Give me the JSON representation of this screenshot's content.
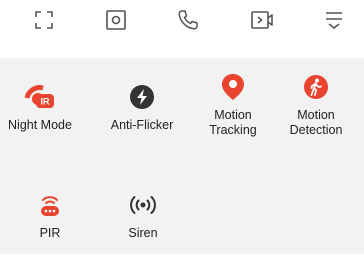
{
  "toolbar": {
    "icons": [
      "fullscreen-icon",
      "snapshot-icon",
      "call-icon",
      "record-video-icon",
      "more-menu-icon"
    ],
    "icon_color": "#555555"
  },
  "accent_color": "#e8442f",
  "features": [
    {
      "label": "Night Mode",
      "icon": "night-mode-ir-icon",
      "color": "#e8442f"
    },
    {
      "label": "Anti-Flicker",
      "icon": "lightning-icon",
      "color": "#333333"
    },
    {
      "label": "Motion\nTracking",
      "icon": "location-pin-icon",
      "color": "#e8442f"
    },
    {
      "label": "Motion\nDetection",
      "icon": "walking-person-icon",
      "color": "#e8442f"
    },
    {
      "label": "PIR",
      "icon": "pir-sensor-icon",
      "color": "#e8442f"
    },
    {
      "label": "Siren",
      "icon": "siren-icon",
      "color": "#333333"
    }
  ]
}
